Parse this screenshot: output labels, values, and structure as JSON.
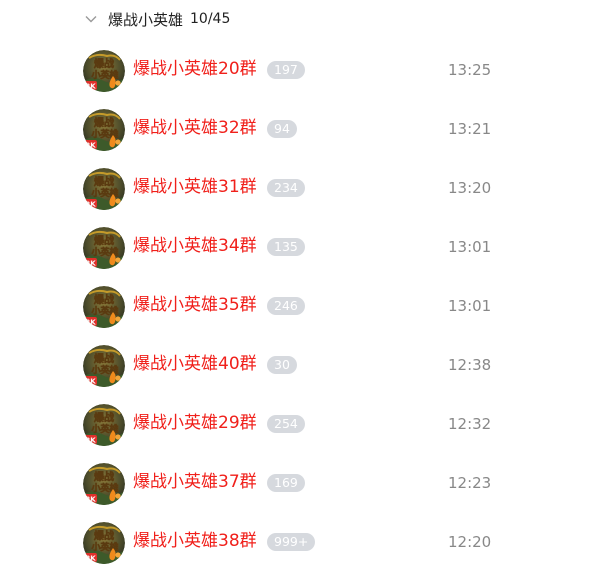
{
  "group": {
    "name": "爆战小英雄",
    "count": "10/45"
  },
  "chats": [
    {
      "name": "爆战小英雄20群",
      "badge": "197",
      "time": "13:25"
    },
    {
      "name": "爆战小英雄32群",
      "badge": "94",
      "time": "13:21"
    },
    {
      "name": "爆战小英雄31群",
      "badge": "234",
      "time": "13:20"
    },
    {
      "name": "爆战小英雄34群",
      "badge": "135",
      "time": "13:01"
    },
    {
      "name": "爆战小英雄35群",
      "badge": "246",
      "time": "13:01"
    },
    {
      "name": "爆战小英雄40群",
      "badge": "30",
      "time": "12:38"
    },
    {
      "name": "爆战小英雄29群",
      "badge": "254",
      "time": "12:32"
    },
    {
      "name": "爆战小英雄37群",
      "badge": "169",
      "time": "12:23"
    },
    {
      "name": "爆战小英雄38群",
      "badge": "999+",
      "time": "12:20"
    }
  ],
  "avatar_text": {
    "line1": "爆战",
    "line2": "小英雄",
    "tag": "2K"
  },
  "colors": {
    "chat_name": "#f0201b",
    "badge_bg": "#d6d9de",
    "time": "#888888"
  },
  "icons": {
    "group_toggle": "chevron-down-icon",
    "avatar": "game-avatar-icon"
  }
}
